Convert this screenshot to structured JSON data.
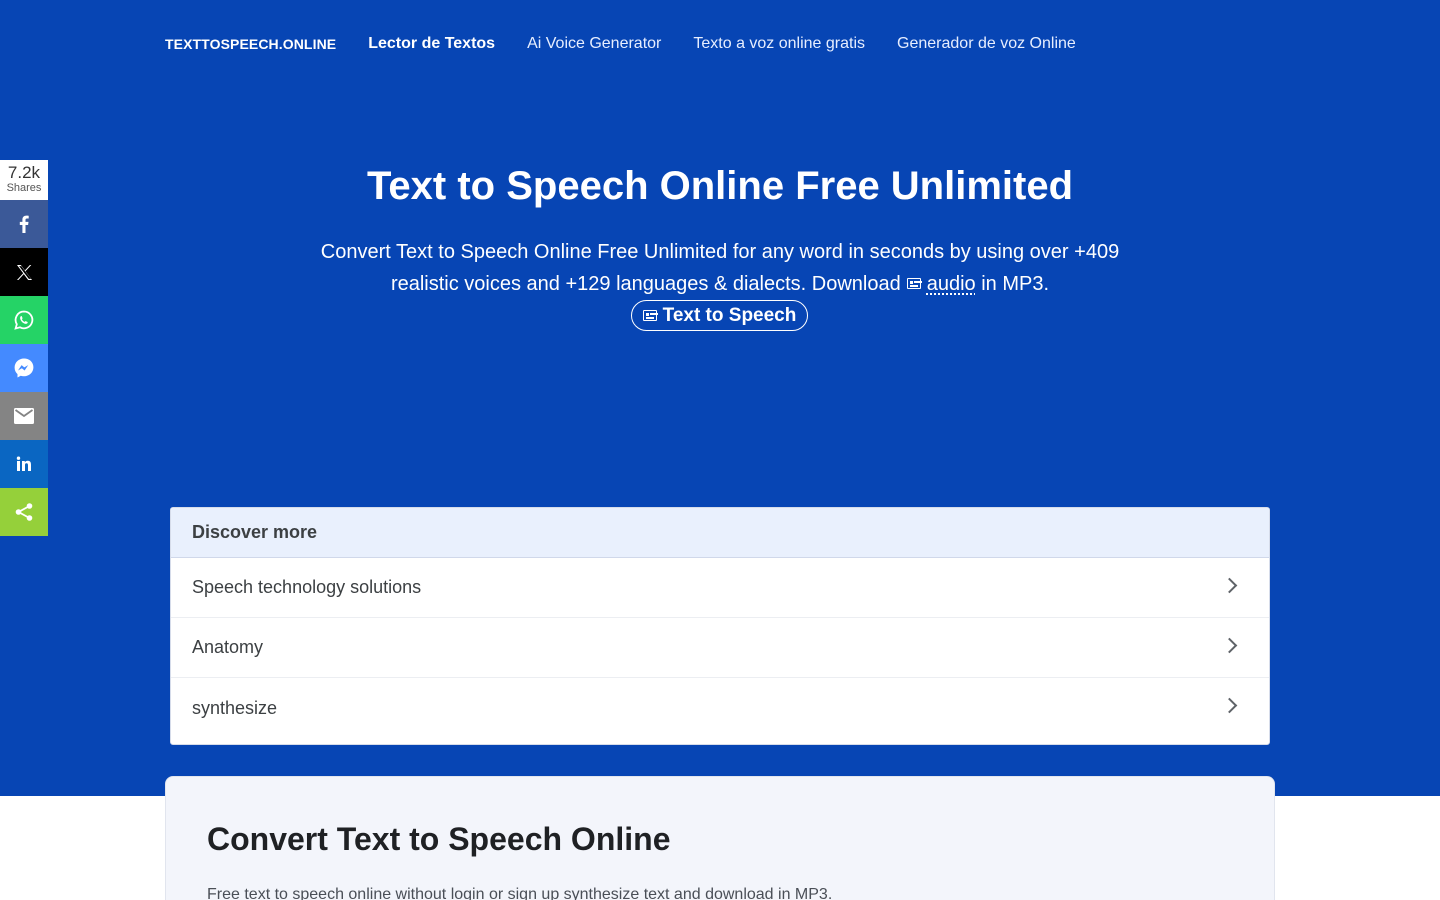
{
  "nav": {
    "brand": "TEXTTOSPEECH.ONLINE",
    "links": [
      {
        "label": "Lector de Textos"
      },
      {
        "label": "Ai Voice Generator"
      },
      {
        "label": "Texto a voz online gratis"
      },
      {
        "label": "Generador de voz Online"
      }
    ]
  },
  "hero": {
    "title": "Text to Speech Online Free Unlimited",
    "subtitle_line1": "Convert Text to Speech Online Free Unlimited for any word in seconds by using over +409",
    "subtitle_line2_a": "realistic voices and +129 languages & dialects. Download",
    "audio_link": "audio",
    "subtitle_line2_b": "in MP3.",
    "button_label": "Text to Speech"
  },
  "share": {
    "count": "7.2k",
    "count_label": "Shares",
    "buttons": [
      "facebook",
      "x",
      "whatsapp",
      "messenger",
      "email",
      "linkedin",
      "share"
    ]
  },
  "discover": {
    "heading": "Discover more",
    "items": [
      {
        "label": "Speech technology solutions"
      },
      {
        "label": "Anatomy"
      },
      {
        "label": "synthesize"
      }
    ]
  },
  "content": {
    "heading": "Convert Text to Speech Online",
    "intro": "Free text to speech online without login or sign up synthesize text and download in MP3."
  },
  "colors": {
    "hero_bg": "#0745b4",
    "facebook": "#3b5998",
    "x": "#000000",
    "whatsapp": "#25d366",
    "messenger": "#448aff",
    "email": "#848484",
    "linkedin": "#0a66c2",
    "share": "#95d03a"
  }
}
